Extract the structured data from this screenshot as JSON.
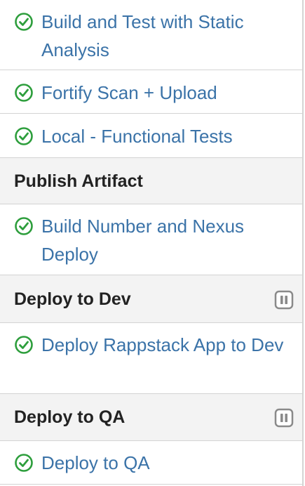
{
  "rows": [
    {
      "kind": "job",
      "label": "Build and Test with Static Analysis",
      "status_icon": "success-check-icon",
      "status_color": "#2d9e3c"
    },
    {
      "kind": "job",
      "label": "Fortify Scan + Upload",
      "status_icon": "success-check-icon",
      "status_color": "#2d9e3c"
    },
    {
      "kind": "job",
      "label": "Local - Functional Tests",
      "status_icon": "success-check-icon",
      "status_color": "#2d9e3c"
    },
    {
      "kind": "stage",
      "label": "Publish Artifact"
    },
    {
      "kind": "job",
      "label": "Build Number and Nexus Deploy",
      "status_icon": "success-check-icon",
      "status_color": "#2d9e3c"
    },
    {
      "kind": "stage",
      "label": "Deploy to Dev",
      "action_icon": "pause-icon"
    },
    {
      "kind": "job",
      "label": "Deploy Rappstack App to Dev",
      "status_icon": "success-check-icon",
      "status_color": "#2d9e3c"
    },
    {
      "kind": "stage",
      "label": "Deploy to QA",
      "action_icon": "pause-icon"
    },
    {
      "kind": "job",
      "label": "Deploy to QA",
      "status_icon": "success-check-icon",
      "status_color": "#2d9e3c"
    }
  ],
  "colors": {
    "link": "#3b73a8",
    "success": "#2d9e3c",
    "stage_background": "#f3f3f3",
    "divider": "#d3d3d3",
    "pause_icon": "#8a8a8a"
  }
}
